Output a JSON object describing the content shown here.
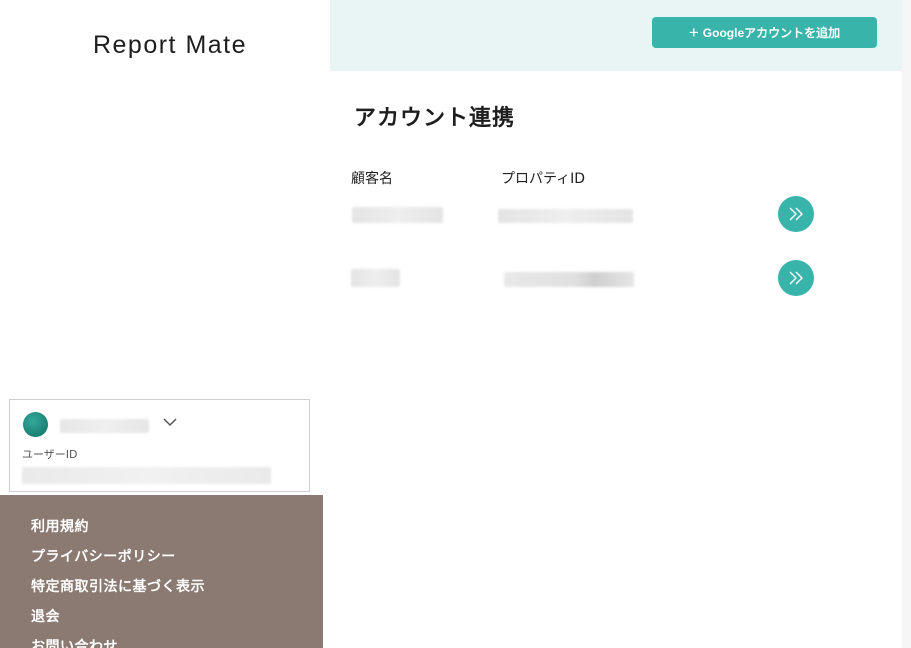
{
  "app": {
    "logo": "Report Mate"
  },
  "sidebar": {
    "user": {
      "id_label": "ユーザーID"
    },
    "footer_links": [
      {
        "label": "利用規約"
      },
      {
        "label": "プライバシーポリシー"
      },
      {
        "label": "特定商取引法に基づく表示"
      },
      {
        "label": "退会"
      },
      {
        "label": "お問い合わせ"
      }
    ]
  },
  "header": {
    "add_google_account_label": "Googleアカウントを追加"
  },
  "main": {
    "title": "アカウント連携",
    "columns": {
      "customer": "顧客名",
      "property_id": "プロパティID"
    }
  },
  "colors": {
    "accent": "#38b4ab",
    "topbar_bg": "#e8f5f4",
    "footer_bg": "#8b7a72"
  },
  "icons": {
    "add": "plus-icon",
    "go": "double-chevron-right-icon",
    "dropdown": "chevron-down-icon"
  }
}
